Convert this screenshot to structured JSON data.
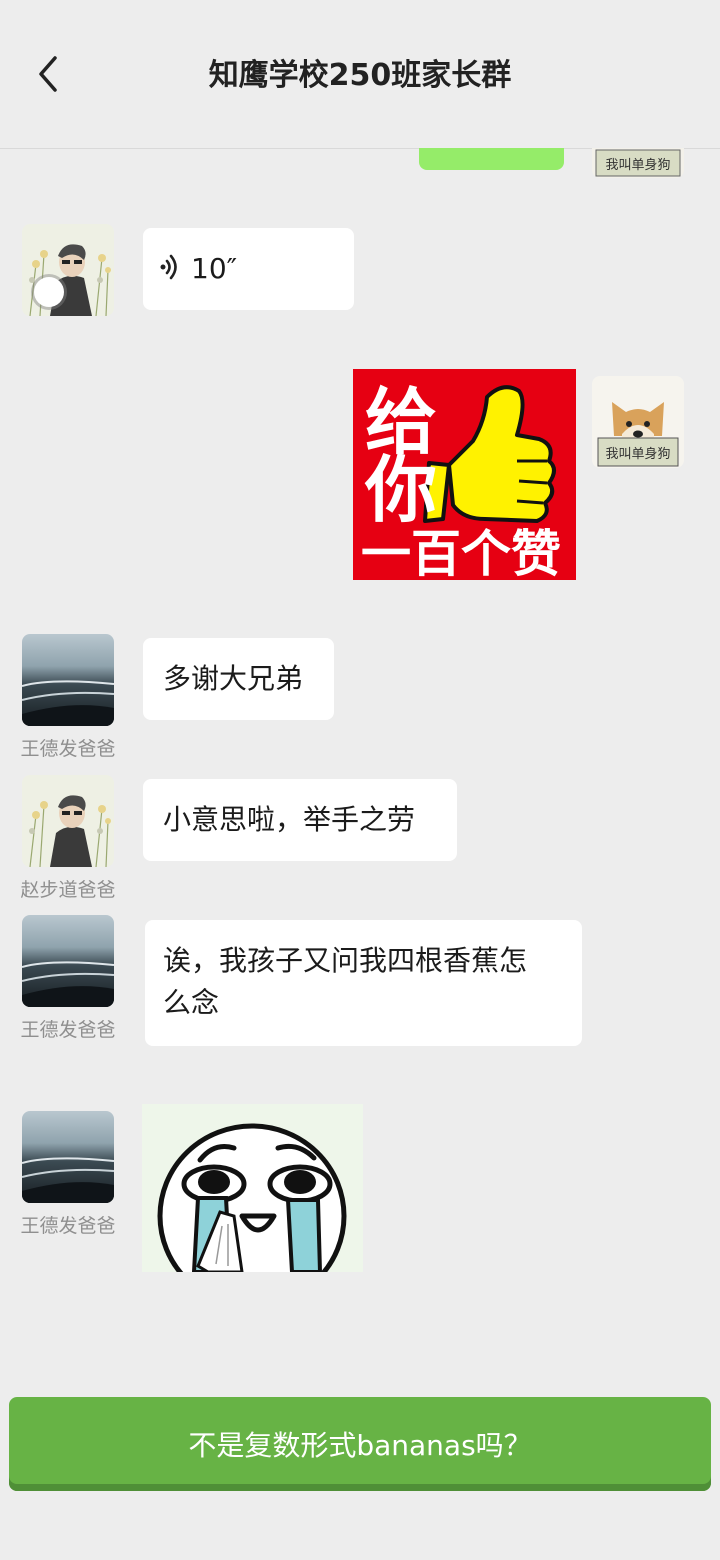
{
  "header": {
    "title": "知鹰学校250班家长群"
  },
  "messages": {
    "voice": {
      "duration": "10″"
    },
    "sticker_thumb": {
      "line1": "给",
      "line2": "你",
      "line3": "一百个赞"
    },
    "msg_thanks": {
      "sender": "王德发爸爸",
      "text": "多谢大兄弟"
    },
    "msg_reply": {
      "sender": "赵步道爸爸",
      "text": "小意思啦，举手之劳"
    },
    "msg_question": {
      "sender": "王德发爸爸",
      "text_line1": "诶，我孩子又问我四根香蕉怎",
      "text_line2": "么念"
    },
    "msg_cry": {
      "sender": "王德发爸爸"
    }
  },
  "avatar_caption": "我叫单身狗",
  "action": {
    "label": "不是复数形式bananas吗？"
  },
  "colors": {
    "background": "#ededed",
    "self_bubble": "#95ec69",
    "action_green": "#67b345",
    "sticker_red": "#e60012"
  }
}
